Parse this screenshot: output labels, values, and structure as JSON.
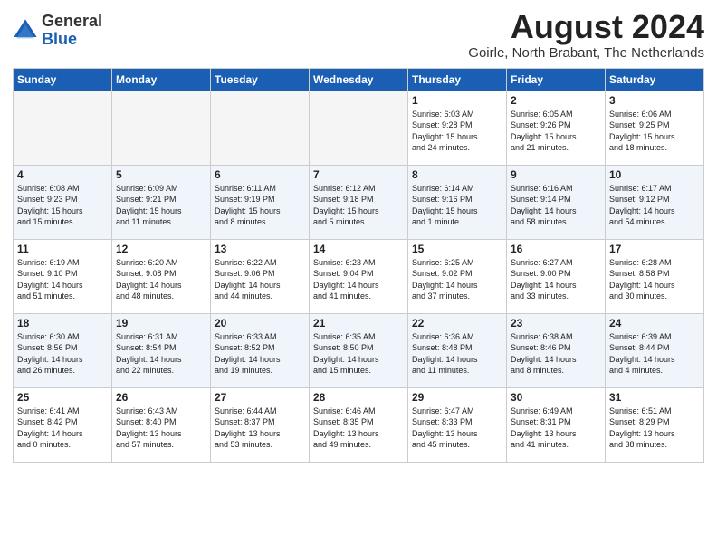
{
  "logo": {
    "general": "General",
    "blue": "Blue"
  },
  "title": "August 2024",
  "subtitle": "Goirle, North Brabant, The Netherlands",
  "weekdays": [
    "Sunday",
    "Monday",
    "Tuesday",
    "Wednesday",
    "Thursday",
    "Friday",
    "Saturday"
  ],
  "weeks": [
    [
      {
        "day": "",
        "info": ""
      },
      {
        "day": "",
        "info": ""
      },
      {
        "day": "",
        "info": ""
      },
      {
        "day": "",
        "info": ""
      },
      {
        "day": "1",
        "info": "Sunrise: 6:03 AM\nSunset: 9:28 PM\nDaylight: 15 hours\nand 24 minutes."
      },
      {
        "day": "2",
        "info": "Sunrise: 6:05 AM\nSunset: 9:26 PM\nDaylight: 15 hours\nand 21 minutes."
      },
      {
        "day": "3",
        "info": "Sunrise: 6:06 AM\nSunset: 9:25 PM\nDaylight: 15 hours\nand 18 minutes."
      }
    ],
    [
      {
        "day": "4",
        "info": "Sunrise: 6:08 AM\nSunset: 9:23 PM\nDaylight: 15 hours\nand 15 minutes."
      },
      {
        "day": "5",
        "info": "Sunrise: 6:09 AM\nSunset: 9:21 PM\nDaylight: 15 hours\nand 11 minutes."
      },
      {
        "day": "6",
        "info": "Sunrise: 6:11 AM\nSunset: 9:19 PM\nDaylight: 15 hours\nand 8 minutes."
      },
      {
        "day": "7",
        "info": "Sunrise: 6:12 AM\nSunset: 9:18 PM\nDaylight: 15 hours\nand 5 minutes."
      },
      {
        "day": "8",
        "info": "Sunrise: 6:14 AM\nSunset: 9:16 PM\nDaylight: 15 hours\nand 1 minute."
      },
      {
        "day": "9",
        "info": "Sunrise: 6:16 AM\nSunset: 9:14 PM\nDaylight: 14 hours\nand 58 minutes."
      },
      {
        "day": "10",
        "info": "Sunrise: 6:17 AM\nSunset: 9:12 PM\nDaylight: 14 hours\nand 54 minutes."
      }
    ],
    [
      {
        "day": "11",
        "info": "Sunrise: 6:19 AM\nSunset: 9:10 PM\nDaylight: 14 hours\nand 51 minutes."
      },
      {
        "day": "12",
        "info": "Sunrise: 6:20 AM\nSunset: 9:08 PM\nDaylight: 14 hours\nand 48 minutes."
      },
      {
        "day": "13",
        "info": "Sunrise: 6:22 AM\nSunset: 9:06 PM\nDaylight: 14 hours\nand 44 minutes."
      },
      {
        "day": "14",
        "info": "Sunrise: 6:23 AM\nSunset: 9:04 PM\nDaylight: 14 hours\nand 41 minutes."
      },
      {
        "day": "15",
        "info": "Sunrise: 6:25 AM\nSunset: 9:02 PM\nDaylight: 14 hours\nand 37 minutes."
      },
      {
        "day": "16",
        "info": "Sunrise: 6:27 AM\nSunset: 9:00 PM\nDaylight: 14 hours\nand 33 minutes."
      },
      {
        "day": "17",
        "info": "Sunrise: 6:28 AM\nSunset: 8:58 PM\nDaylight: 14 hours\nand 30 minutes."
      }
    ],
    [
      {
        "day": "18",
        "info": "Sunrise: 6:30 AM\nSunset: 8:56 PM\nDaylight: 14 hours\nand 26 minutes."
      },
      {
        "day": "19",
        "info": "Sunrise: 6:31 AM\nSunset: 8:54 PM\nDaylight: 14 hours\nand 22 minutes."
      },
      {
        "day": "20",
        "info": "Sunrise: 6:33 AM\nSunset: 8:52 PM\nDaylight: 14 hours\nand 19 minutes."
      },
      {
        "day": "21",
        "info": "Sunrise: 6:35 AM\nSunset: 8:50 PM\nDaylight: 14 hours\nand 15 minutes."
      },
      {
        "day": "22",
        "info": "Sunrise: 6:36 AM\nSunset: 8:48 PM\nDaylight: 14 hours\nand 11 minutes."
      },
      {
        "day": "23",
        "info": "Sunrise: 6:38 AM\nSunset: 8:46 PM\nDaylight: 14 hours\nand 8 minutes."
      },
      {
        "day": "24",
        "info": "Sunrise: 6:39 AM\nSunset: 8:44 PM\nDaylight: 14 hours\nand 4 minutes."
      }
    ],
    [
      {
        "day": "25",
        "info": "Sunrise: 6:41 AM\nSunset: 8:42 PM\nDaylight: 14 hours\nand 0 minutes."
      },
      {
        "day": "26",
        "info": "Sunrise: 6:43 AM\nSunset: 8:40 PM\nDaylight: 13 hours\nand 57 minutes."
      },
      {
        "day": "27",
        "info": "Sunrise: 6:44 AM\nSunset: 8:37 PM\nDaylight: 13 hours\nand 53 minutes."
      },
      {
        "day": "28",
        "info": "Sunrise: 6:46 AM\nSunset: 8:35 PM\nDaylight: 13 hours\nand 49 minutes."
      },
      {
        "day": "29",
        "info": "Sunrise: 6:47 AM\nSunset: 8:33 PM\nDaylight: 13 hours\nand 45 minutes."
      },
      {
        "day": "30",
        "info": "Sunrise: 6:49 AM\nSunset: 8:31 PM\nDaylight: 13 hours\nand 41 minutes."
      },
      {
        "day": "31",
        "info": "Sunrise: 6:51 AM\nSunset: 8:29 PM\nDaylight: 13 hours\nand 38 minutes."
      }
    ]
  ]
}
